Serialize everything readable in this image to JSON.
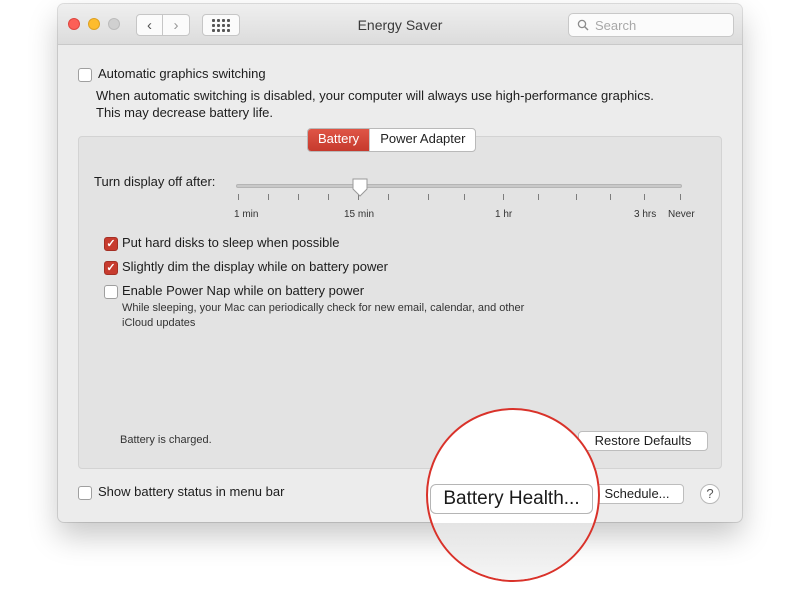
{
  "window": {
    "title": "Energy Saver",
    "search_placeholder": "Search"
  },
  "toolbar": {
    "back_glyph": "‹",
    "forward_glyph": "›"
  },
  "graphics": {
    "checkbox_label": "Automatic graphics switching",
    "checked": false,
    "description_line1": "When automatic switching is disabled, your computer will always use high-performance graphics.",
    "description_line2": "This may decrease battery life."
  },
  "tabs": [
    {
      "label": "Battery",
      "selected": true
    },
    {
      "label": "Power Adapter",
      "selected": false
    }
  ],
  "display_off": {
    "label": "Turn display off after:",
    "value": "15 min",
    "tick_labels": [
      "1 min",
      "15 min",
      "1 hr",
      "3 hrs",
      "Never"
    ]
  },
  "options": [
    {
      "label": "Put hard disks to sleep when possible",
      "checked": true
    },
    {
      "label": "Slightly dim the display while on battery power",
      "checked": true
    },
    {
      "label": "Enable Power Nap while on battery power",
      "checked": false
    }
  ],
  "power_nap_description": {
    "line1": "While sleeping, your Mac can periodically check for new email, calendar, and other",
    "line2": "iCloud updates"
  },
  "battery_status": "Battery is charged.",
  "buttons": {
    "restore_defaults": "Restore Defaults",
    "battery_health": "Battery Health...",
    "schedule": "Schedule...",
    "help": "?"
  },
  "show_status": {
    "label": "Show battery status in menu bar",
    "checked": false
  },
  "colors": {
    "accent": "#c73b2e",
    "highlight_circle": "#d9322a"
  },
  "icons": {
    "back": "chevron-left-icon",
    "forward": "chevron-right-icon",
    "grid": "show-all-grid-icon",
    "search": "magnifying-glass-icon",
    "knob": "slider-knob-icon"
  }
}
